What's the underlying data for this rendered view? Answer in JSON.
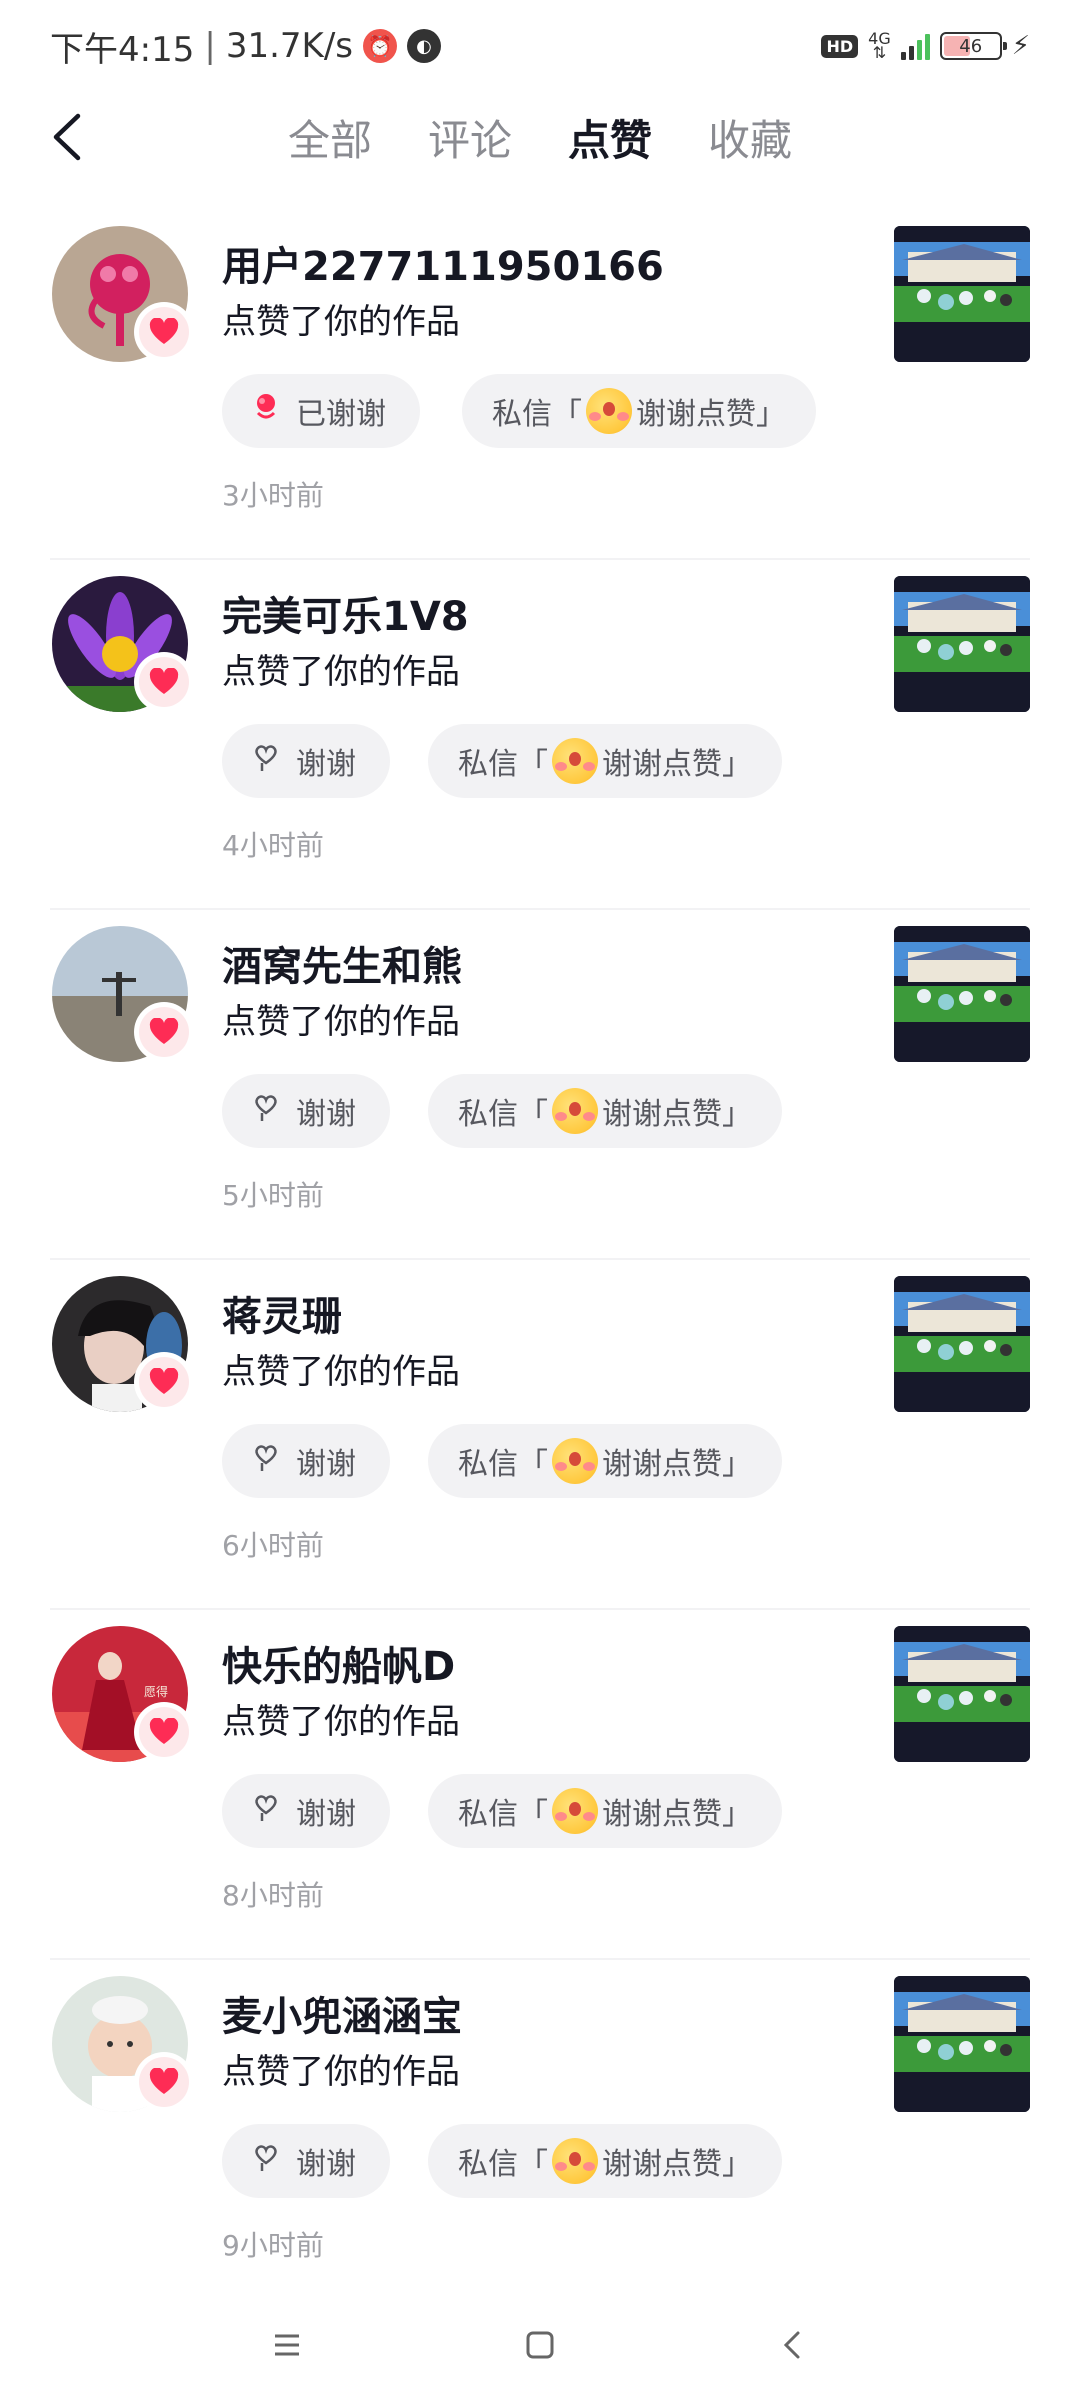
{
  "status_bar": {
    "time": "下午4:15",
    "net_speed": "31.7K/s",
    "hd": "HD",
    "network": "4G",
    "battery": "46"
  },
  "tabs": [
    {
      "label": "全部",
      "active": false
    },
    {
      "label": "评论",
      "active": false
    },
    {
      "label": "点赞",
      "active": true
    },
    {
      "label": "收藏",
      "active": false
    }
  ],
  "dm_prefix": "私信「",
  "dm_text": "谢谢点赞」",
  "items": [
    {
      "name": "用户2277111950166",
      "action": "点赞了你的作品",
      "thanks_label": "已谢谢",
      "thanked": true,
      "time": "3小时前"
    },
    {
      "name": "完美可乐1V8",
      "action": "点赞了你的作品",
      "thanks_label": "谢谢",
      "thanked": false,
      "time": "4小时前"
    },
    {
      "name": "酒窝先生和熊",
      "action": "点赞了你的作品",
      "thanks_label": "谢谢",
      "thanked": false,
      "time": "5小时前"
    },
    {
      "name": "蒋灵珊",
      "action": "点赞了你的作品",
      "thanks_label": "谢谢",
      "thanked": false,
      "time": "6小时前"
    },
    {
      "name": "快乐的船帆D",
      "action": "点赞了你的作品",
      "thanks_label": "谢谢",
      "thanked": false,
      "time": "8小时前"
    },
    {
      "name": "麦小兜涵涵宝",
      "action": "点赞了你的作品",
      "thanks_label": "谢谢",
      "thanked": false,
      "time": "9小时前"
    }
  ],
  "colors": {
    "heart": "#fe2c55",
    "text_primary": "#161823",
    "text_secondary": "#a0a1a6",
    "chip_bg": "#f2f2f4"
  }
}
